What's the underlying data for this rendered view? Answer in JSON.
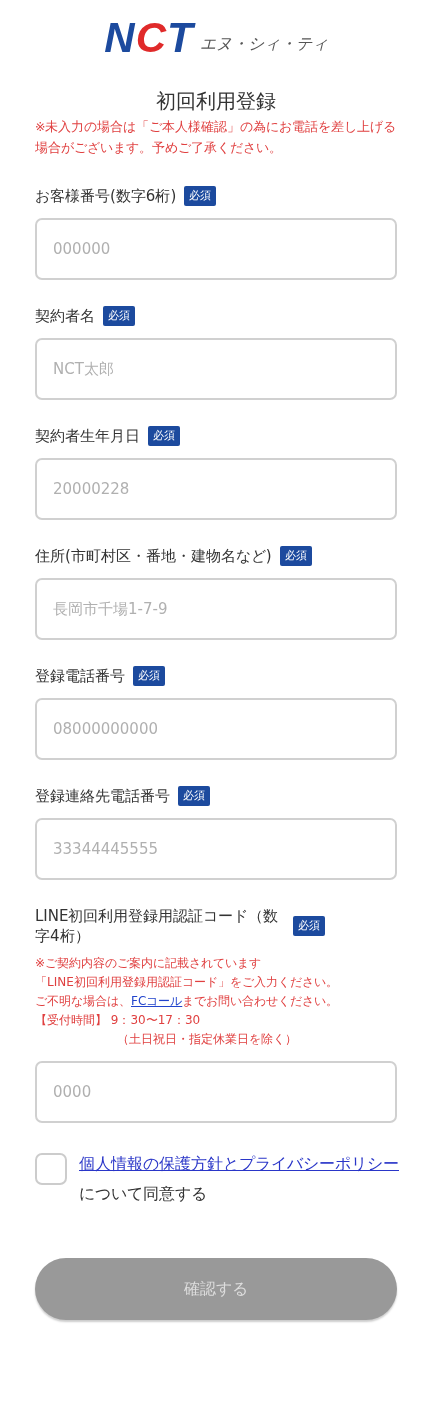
{
  "logo": {
    "letters": [
      {
        "text": "N",
        "color": "#1c4a9e"
      },
      {
        "text": "C",
        "color": "#e02a2a"
      },
      {
        "text": "T",
        "color": "#1c4a9e"
      }
    ],
    "reading": "エヌ・シィ・ティ"
  },
  "title": "初回利用登録",
  "notice": "※未入力の場合は「ご本人様確認」の為にお電話を差し上げる場合がございます。予めご了承ください。",
  "fields": [
    {
      "label": "お客様番号(数字6桁)",
      "badge": "必須",
      "placeholder": "000000"
    },
    {
      "label": "契約者名",
      "badge": "必須",
      "placeholder": "NCT太郎"
    },
    {
      "label": "契約者生年月日",
      "badge": "必須",
      "placeholder": "20000228"
    },
    {
      "label": "住所(市町村区・番地・建物名など)",
      "badge": "必須",
      "placeholder": "長岡市千場1-7-9"
    },
    {
      "label": "登録電話番号",
      "badge": "必須",
      "placeholder": "08000000000"
    },
    {
      "label": "登録連絡先電話番号",
      "badge": "必須",
      "placeholder": "33344445555"
    },
    {
      "label": "LINE初回利用登録用認証コード（数字4桁）",
      "badge": "必須",
      "placeholder": "0000",
      "notes": [
        {
          "kind": "line",
          "text": "※ご契約内容のご案内に記載されています"
        },
        {
          "kind": "line",
          "text": "「LINE初回利用登録用認証コード」をご入力ください。"
        },
        {
          "kind": "link",
          "before": "ご不明な場合は、",
          "link": "FCコール",
          "after": "までお問い合わせください。"
        },
        {
          "kind": "line",
          "text": "【受付時間】 9：30〜17：30"
        },
        {
          "kind": "indented",
          "text": "（土日祝日・指定休業日を除く）"
        }
      ]
    }
  ],
  "consent": {
    "checked": false,
    "link": "個人情報の保護方針とプライバシーポリシー",
    "text": "について同意する"
  },
  "submit": {
    "label": "確認する",
    "disabled": true
  }
}
